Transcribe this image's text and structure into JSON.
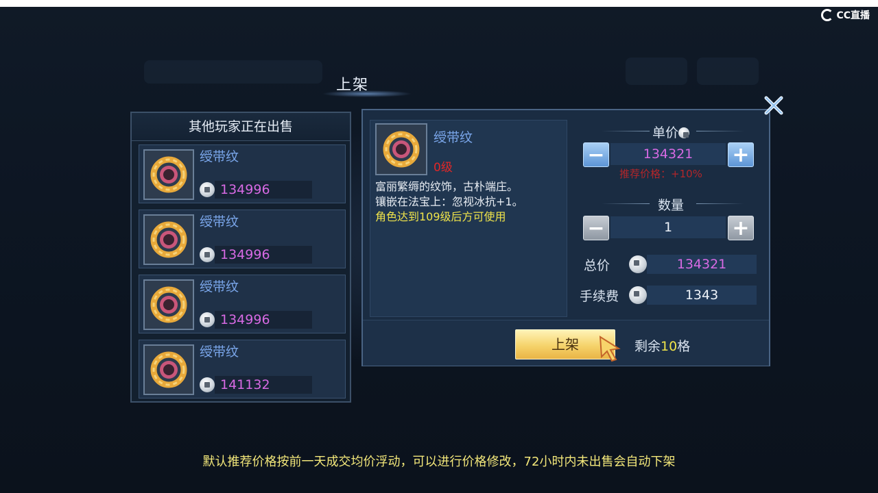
{
  "brand": {
    "logo_text": "CC直播"
  },
  "window": {
    "title": "上架"
  },
  "other_listings": {
    "header": "其他玩家正在出售",
    "items": [
      {
        "name": "绶带纹",
        "price": "134996",
        "icon": "ring-ornament-icon"
      },
      {
        "name": "绶带纹",
        "price": "134996",
        "icon": "ring-ornament-icon"
      },
      {
        "name": "绶带纹",
        "price": "134996",
        "icon": "ring-ornament-icon"
      },
      {
        "name": "绶带纹",
        "price": "141132",
        "icon": "ring-ornament-icon"
      }
    ]
  },
  "item_detail": {
    "name": "绶带纹",
    "level": "0级",
    "desc_line1": "富丽繁缛的纹饰，古朴端庄。",
    "desc_line2": "镶嵌在法宝上：忽视冰抗+1。",
    "requirement": "角色达到109级后方可使用",
    "icon": "ring-ornament-icon"
  },
  "pricing": {
    "unit_price_label": "单价",
    "unit_price": "134321",
    "recommend_hint": "推荐价格：+10%",
    "minus_label": "−",
    "plus_label": "+",
    "quantity_label": "数量",
    "quantity": "1",
    "total_label": "总价",
    "total": "134321",
    "fee_label": "手续费",
    "fee": "1343"
  },
  "actions": {
    "list_button": "上架",
    "remaining_prefix": "剩余",
    "remaining_count": "10",
    "remaining_suffix": "格"
  },
  "footer": {
    "note": "默认推荐价格按前一天成交均价浮动，可以进行价格修改，72小时内未出售会自动下架"
  },
  "colors": {
    "item_name": "#7aa6ea",
    "price": "#d86ae4",
    "level": "#e22727",
    "requirement": "#f0e44a",
    "button_gold": "#f5d36b"
  }
}
